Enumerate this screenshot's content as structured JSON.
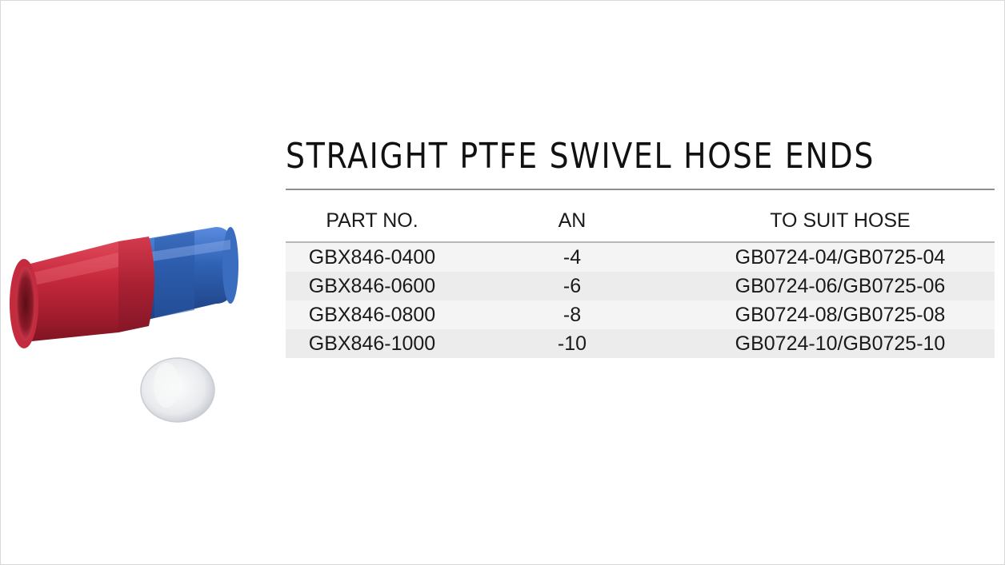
{
  "title": "STRAIGHT PTFE SWIVEL HOSE ENDS",
  "table": {
    "headers": [
      "PART NO.",
      "AN",
      "TO SUIT HOSE"
    ],
    "rows": [
      [
        "GBX846-0400",
        "-4",
        "GB0724-04/GB0725-04"
      ],
      [
        "GBX846-0600",
        "-6",
        "GB0724-06/GB0725-06"
      ],
      [
        "GBX846-0800",
        "-8",
        "GB0724-08/GB0725-08"
      ],
      [
        "GBX846-1000",
        "-10",
        "GB0724-10/GB0725-10"
      ]
    ]
  },
  "product_image": {
    "depicts": "red and blue anodized PTFE hose end fitting with white olive",
    "colors": {
      "red": "#c0273a",
      "blue": "#2f62b3",
      "olive": "#e8eaed"
    }
  }
}
